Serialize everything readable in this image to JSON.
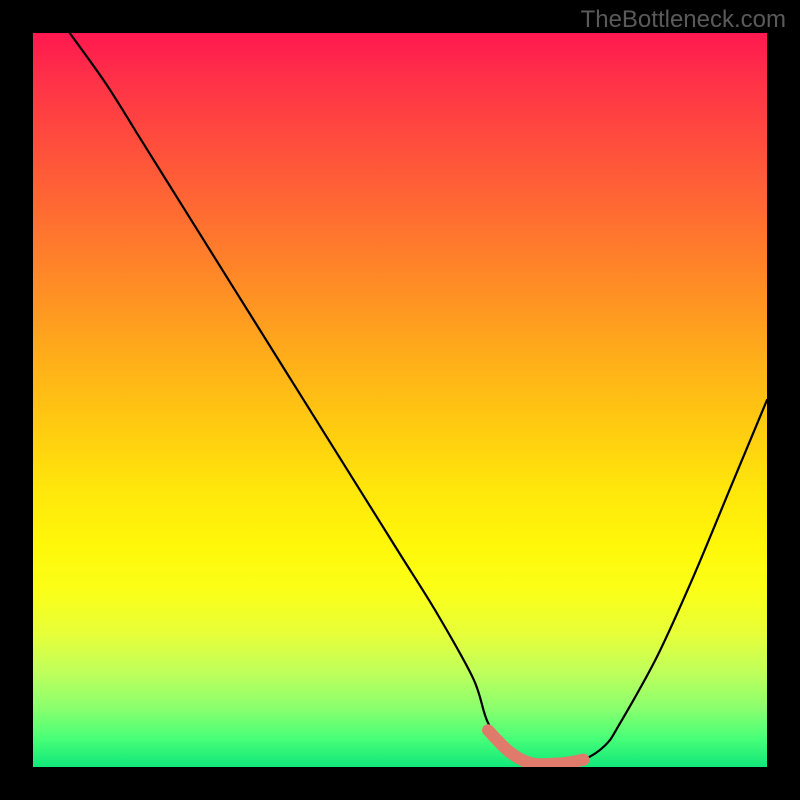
{
  "watermark": "TheBottleneck.com",
  "chart_data": {
    "type": "line",
    "title": "",
    "xlabel": "",
    "ylabel": "",
    "xlim": [
      0,
      100
    ],
    "ylim": [
      0,
      100
    ],
    "grid": false,
    "series": [
      {
        "name": "curve",
        "x": [
          5,
          10,
          15,
          20,
          25,
          30,
          35,
          40,
          45,
          50,
          55,
          60,
          62,
          65,
          68,
          72,
          75,
          78,
          80,
          85,
          90,
          95,
          100
        ],
        "values": [
          100,
          93,
          85,
          77,
          69,
          61,
          53,
          45,
          37,
          29,
          21,
          12,
          6,
          2,
          0.5,
          0.5,
          1,
          3,
          6,
          15,
          26,
          38,
          50
        ],
        "color": "#000000"
      },
      {
        "name": "highlight-segment",
        "x": [
          62,
          65,
          68,
          72,
          75
        ],
        "values": [
          5,
          2,
          0.5,
          0.5,
          1
        ],
        "color": "#e07a6a"
      }
    ],
    "gradient_stops": [
      {
        "pos": 0,
        "color": "#ff1850"
      },
      {
        "pos": 24,
        "color": "#ff6a32"
      },
      {
        "pos": 54,
        "color": "#ffcc10"
      },
      {
        "pos": 76,
        "color": "#fbff18"
      },
      {
        "pos": 100,
        "color": "#10e87a"
      }
    ]
  }
}
